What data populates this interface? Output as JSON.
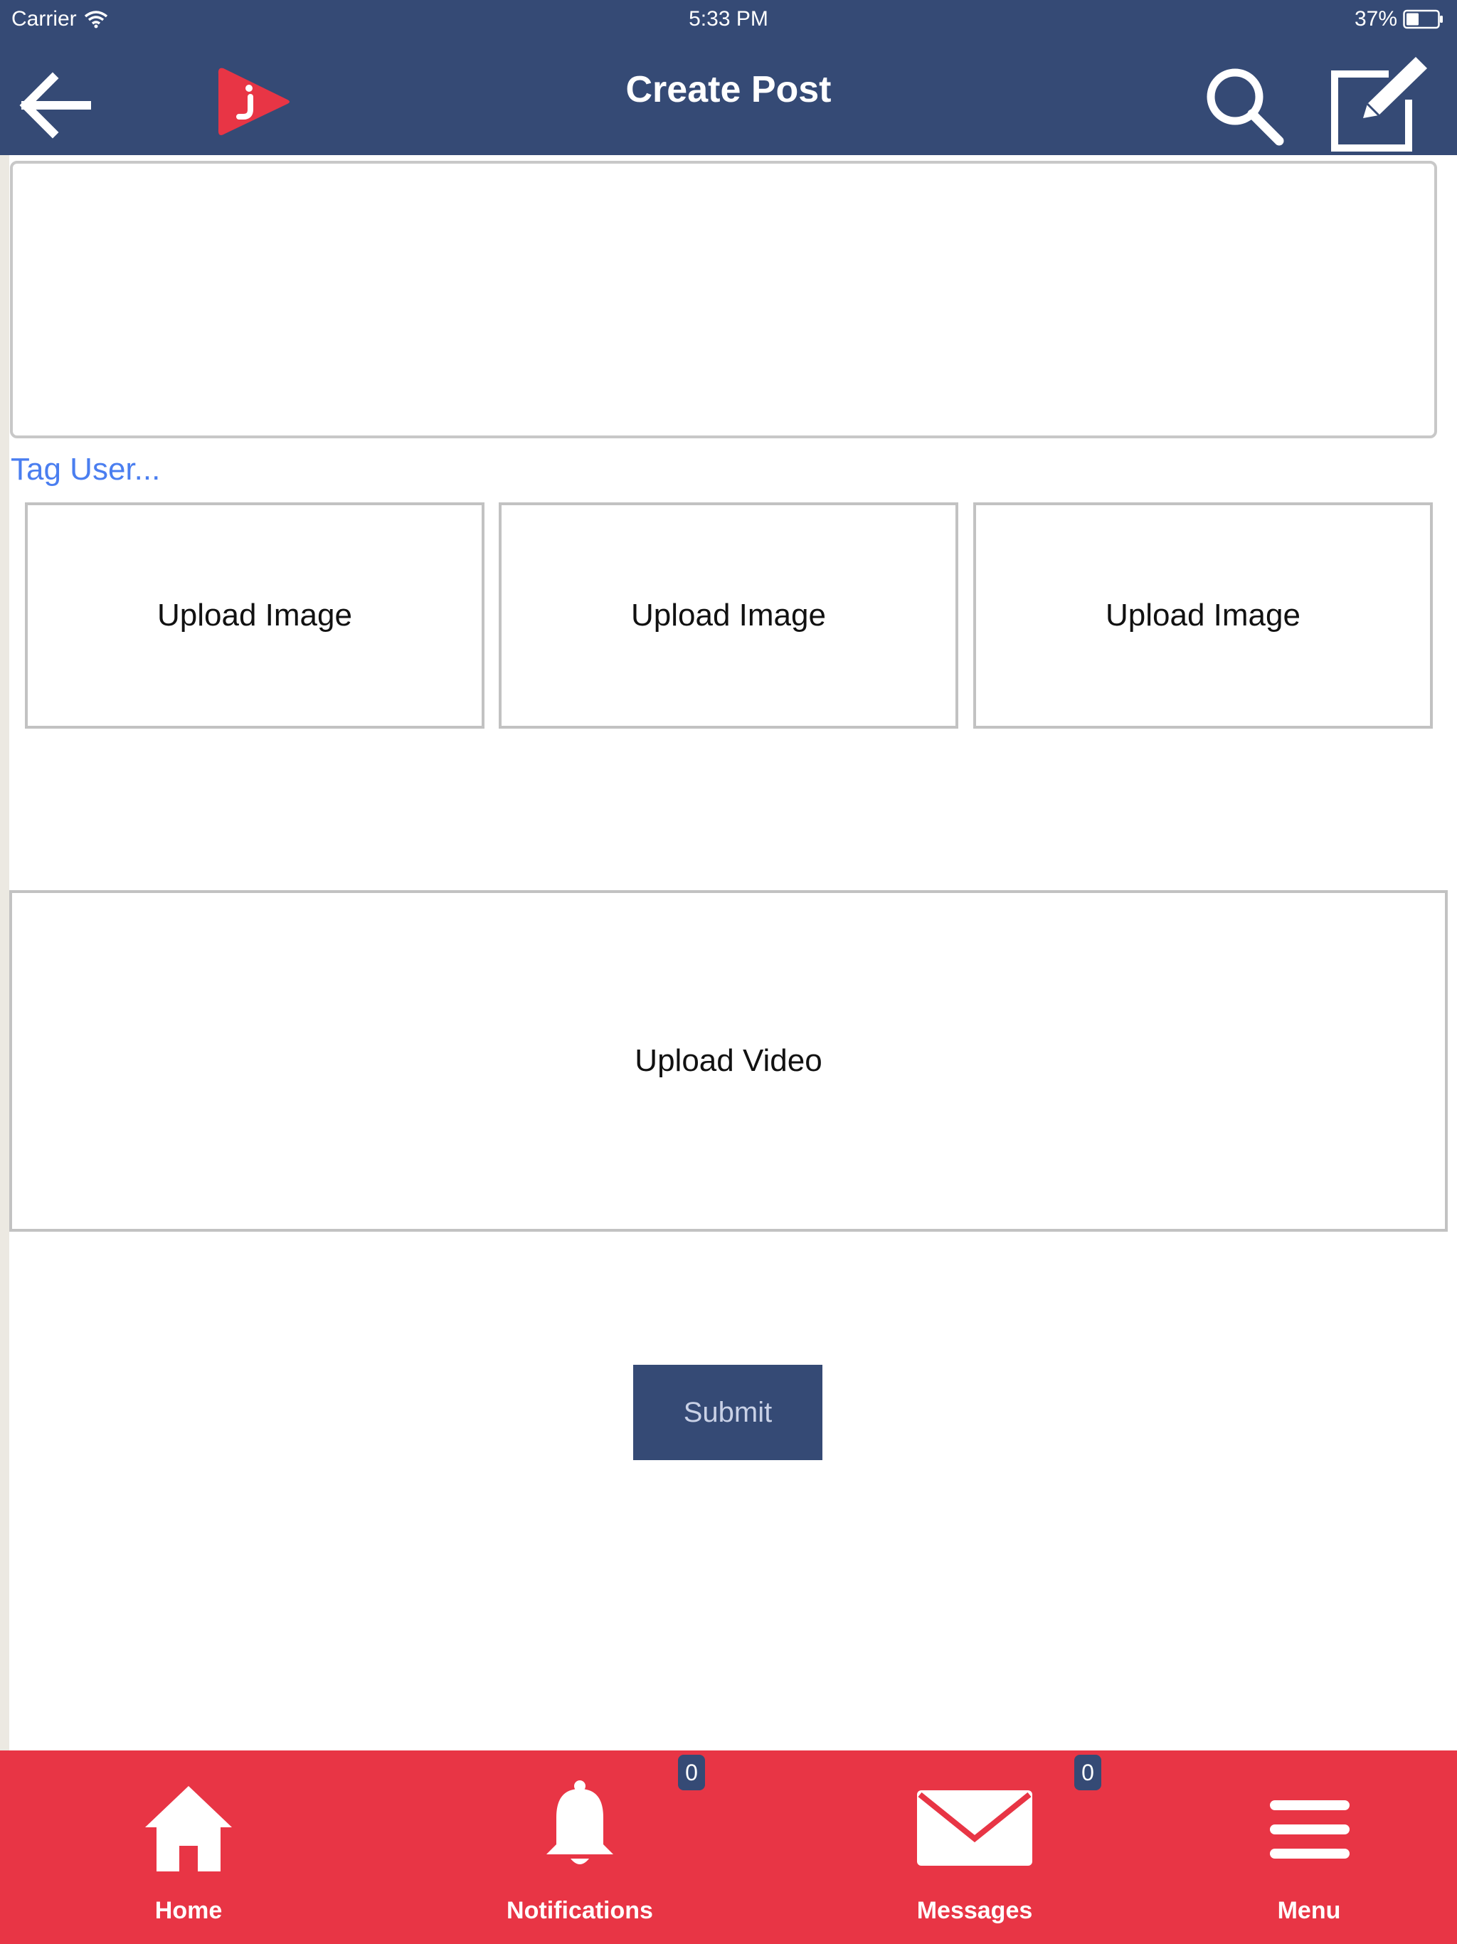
{
  "status_bar": {
    "carrier": "Carrier",
    "time": "5:33 PM",
    "battery": "37%"
  },
  "header": {
    "title": "Create Post",
    "icons": [
      "back-arrow-icon",
      "app-logo-icon",
      "search-icon",
      "compose-icon"
    ]
  },
  "composer": {
    "post_text_value": "",
    "tag_user_label": "Tag User...",
    "upload_image_labels": [
      "Upload Image",
      "Upload Image",
      "Upload Image"
    ],
    "upload_video_label": "Upload Video",
    "submit_label": "Submit"
  },
  "tab_bar": {
    "tabs": [
      {
        "label": "Home",
        "icon": "home-icon"
      },
      {
        "label": "Notifications",
        "icon": "bell-icon",
        "badge": "0"
      },
      {
        "label": "Messages",
        "icon": "envelope-icon",
        "badge": "0"
      },
      {
        "label": "Menu",
        "icon": "hamburger-menu-icon"
      }
    ]
  },
  "colors": {
    "header_bg": "#354a75",
    "tab_bar_bg": "#e83545",
    "link": "#4a7ef0",
    "border": "#c2c2c2"
  }
}
